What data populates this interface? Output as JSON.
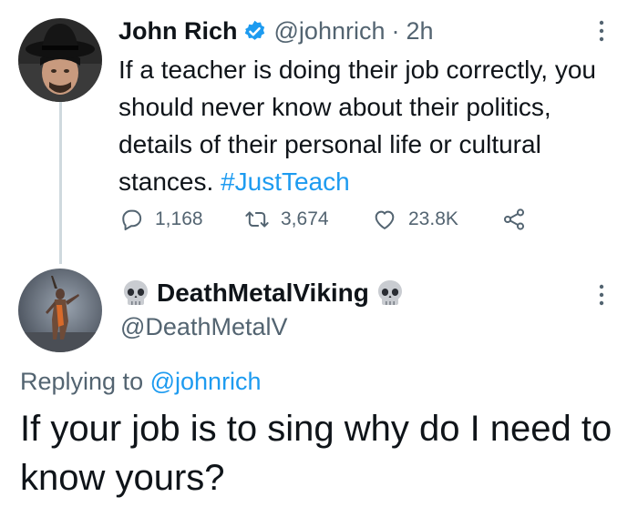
{
  "original_tweet": {
    "author_name": "John Rich",
    "handle": "@johnrich",
    "separator": "·",
    "time": "2h",
    "text": "If a teacher is doing their job correctly, you should never know about their politics, details of their personal life or cultural stances. ",
    "hashtag": "#JustTeach",
    "reply_count": "1,168",
    "retweet_count": "3,674",
    "like_count": "23.8K",
    "icons": [
      "verified-badge-icon",
      "more-options-icon",
      "reply-icon",
      "retweet-icon",
      "like-icon",
      "share-icon"
    ]
  },
  "reply_tweet": {
    "display_name": "DeathMetalViking",
    "handle": "@DeathMetalV",
    "replying_to_label": "Replying to",
    "replying_to_handle": "@johnrich",
    "text": "If your job is to sing why do I need to know yours?",
    "icons": [
      "skull-emoji-icon",
      "more-options-icon"
    ]
  },
  "colors": {
    "accent": "#1d9bf0",
    "text_primary": "#0f1419",
    "text_secondary": "#536471",
    "thread_line": "#cfd9de"
  }
}
